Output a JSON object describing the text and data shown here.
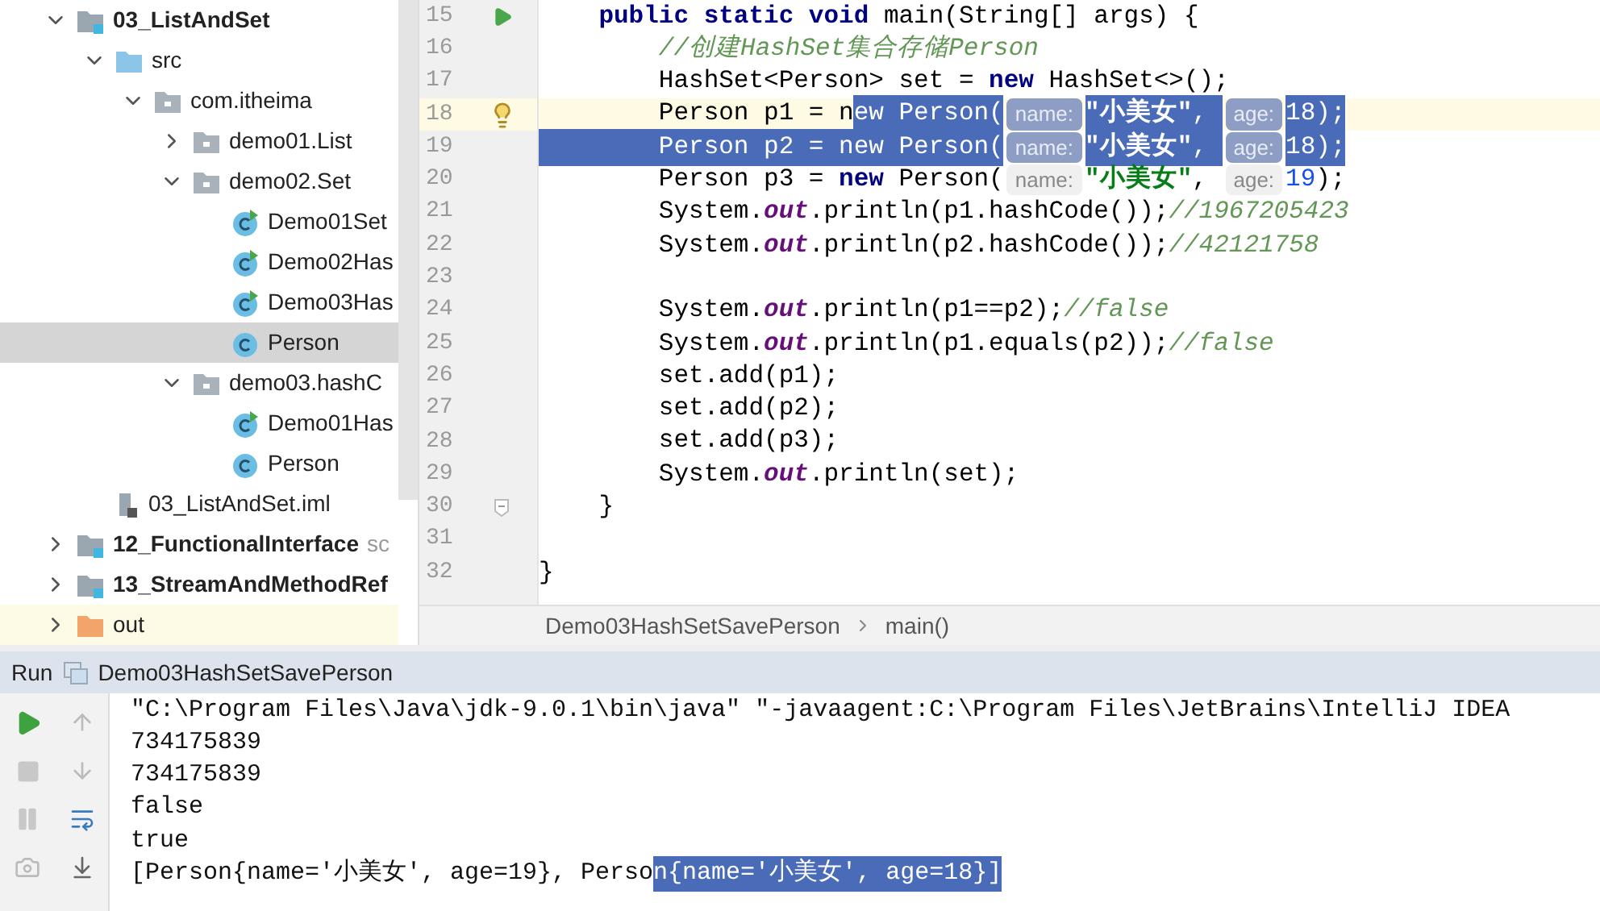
{
  "project_tree": [
    {
      "label": "03_ListAndSet",
      "kind": "module",
      "bold": true,
      "expanded": true,
      "selected": false,
      "highlighted": false,
      "children": [
        {
          "label": "src",
          "kind": "source-folder",
          "bold": false,
          "expanded": true,
          "selected": false,
          "highlighted": false,
          "children": [
            {
              "label": "com.itheima",
              "kind": "package",
              "bold": false,
              "expanded": true,
              "selected": false,
              "highlighted": false,
              "children": [
                {
                  "label": "demo01.List",
                  "kind": "package",
                  "bold": false,
                  "expanded": false,
                  "selected": false,
                  "highlighted": false
                },
                {
                  "label": "demo02.Set",
                  "kind": "package",
                  "bold": false,
                  "expanded": true,
                  "selected": false,
                  "highlighted": false,
                  "children": [
                    {
                      "label": "Demo01Set",
                      "kind": "runnable-class",
                      "bold": false,
                      "selected": false,
                      "highlighted": false
                    },
                    {
                      "label": "Demo02Has",
                      "kind": "runnable-class",
                      "bold": false,
                      "selected": false,
                      "highlighted": false
                    },
                    {
                      "label": "Demo03Has",
                      "kind": "runnable-class",
                      "bold": false,
                      "selected": false,
                      "highlighted": false
                    },
                    {
                      "label": "Person",
                      "kind": "class",
                      "bold": false,
                      "selected": true,
                      "highlighted": false
                    }
                  ]
                },
                {
                  "label": "demo03.hashC",
                  "kind": "package",
                  "bold": false,
                  "expanded": true,
                  "selected": false,
                  "highlighted": false,
                  "children": [
                    {
                      "label": "Demo01Has",
                      "kind": "runnable-class",
                      "bold": false,
                      "selected": false,
                      "highlighted": false
                    },
                    {
                      "label": "Person",
                      "kind": "class",
                      "bold": false,
                      "selected": false,
                      "highlighted": false
                    }
                  ]
                }
              ]
            }
          ]
        },
        {
          "label": "03_ListAndSet.iml",
          "kind": "iml",
          "bold": false,
          "selected": false,
          "highlighted": false
        }
      ]
    },
    {
      "label": "12_FunctionalInterface",
      "suffix": "sc",
      "kind": "module",
      "bold": true,
      "expanded": false,
      "selected": false,
      "highlighted": false
    },
    {
      "label": "13_StreamAndMethodRef",
      "kind": "module",
      "bold": true,
      "expanded": false,
      "selected": false,
      "highlighted": false
    },
    {
      "label": "out",
      "kind": "output-folder",
      "bold": false,
      "expanded": false,
      "selected": false,
      "highlighted": true
    }
  ],
  "editor": {
    "lines": [
      {
        "number": "15",
        "kind": "run",
        "current": false,
        "tokens": [
          {
            "text": "    public static void ",
            "kind": "keyword",
            "selected": false
          },
          {
            "text": "main(String[] args) {",
            "kind": "plain",
            "selected": false
          }
        ]
      },
      {
        "number": "16",
        "kind": "plain",
        "current": false,
        "tokens": [
          {
            "text": "        //创建HashSet集合存储Person",
            "kind": "comment",
            "selected": false
          }
        ]
      },
      {
        "number": "17",
        "kind": "plain",
        "current": false,
        "tokens": [
          {
            "text": "        HashSet<Person> set = ",
            "kind": "plain",
            "selected": false
          },
          {
            "text": "new ",
            "kind": "keyword",
            "selected": false
          },
          {
            "text": "HashSet<>();",
            "kind": "plain",
            "selected": false
          }
        ]
      },
      {
        "number": "18",
        "kind": "bulb",
        "current": true,
        "tokens": [
          {
            "text": "        Person p1 = n",
            "kind": "plain",
            "selected": false
          },
          {
            "text": "ew ",
            "kind": "keyword",
            "selected": true
          },
          {
            "text": "Person(",
            "kind": "plain",
            "selected": true
          },
          {
            "text": "name:",
            "kind": "hint",
            "selected": true
          },
          {
            "text": "\"小美女\"",
            "kind": "string",
            "selected": true
          },
          {
            "text": ", ",
            "kind": "plain",
            "selected": true
          },
          {
            "text": "age:",
            "kind": "hint",
            "selected": true
          },
          {
            "text": "18",
            "kind": "number",
            "selected": true
          },
          {
            "text": ");",
            "kind": "plain",
            "selected": true
          }
        ]
      },
      {
        "number": "19",
        "kind": "plain",
        "current": false,
        "tokens": [
          {
            "text": "        Person p2 = ",
            "kind": "plain",
            "selected": true
          },
          {
            "text": "new ",
            "kind": "keyword",
            "selected": true
          },
          {
            "text": "Person(",
            "kind": "plain",
            "selected": true
          },
          {
            "text": "name:",
            "kind": "hint",
            "selected": true
          },
          {
            "text": "\"小美女\"",
            "kind": "string",
            "selected": true
          },
          {
            "text": ", ",
            "kind": "plain",
            "selected": true
          },
          {
            "text": "age:",
            "kind": "hint",
            "selected": true
          },
          {
            "text": "18",
            "kind": "number",
            "selected": true
          },
          {
            "text": ");",
            "kind": "plain",
            "selected": true
          }
        ]
      },
      {
        "number": "20",
        "kind": "plain",
        "current": false,
        "tokens": [
          {
            "text": "        Person p3 = ",
            "kind": "plain",
            "selected": false
          },
          {
            "text": "new ",
            "kind": "keyword",
            "selected": false
          },
          {
            "text": "Person(",
            "kind": "plain",
            "selected": false
          },
          {
            "text": "name:",
            "kind": "hint",
            "selected": false
          },
          {
            "text": "\"小美女\"",
            "kind": "string",
            "selected": false
          },
          {
            "text": ", ",
            "kind": "plain",
            "selected": false
          },
          {
            "text": "age:",
            "kind": "hint",
            "selected": false
          },
          {
            "text": "19",
            "kind": "number",
            "selected": false
          },
          {
            "text": ");",
            "kind": "plain",
            "selected": false
          }
        ]
      },
      {
        "number": "21",
        "kind": "plain",
        "current": false,
        "tokens": [
          {
            "text": "        System.",
            "kind": "plain",
            "selected": false
          },
          {
            "text": "out",
            "kind": "field",
            "selected": false
          },
          {
            "text": ".println(p1.hashCode());",
            "kind": "plain",
            "selected": false
          },
          {
            "text": "//1967205423",
            "kind": "comment",
            "selected": false
          }
        ]
      },
      {
        "number": "22",
        "kind": "plain",
        "current": false,
        "tokens": [
          {
            "text": "        System.",
            "kind": "plain",
            "selected": false
          },
          {
            "text": "out",
            "kind": "field",
            "selected": false
          },
          {
            "text": ".println(p2.hashCode());",
            "kind": "plain",
            "selected": false
          },
          {
            "text": "//42121758",
            "kind": "comment",
            "selected": false
          }
        ]
      },
      {
        "number": "23",
        "kind": "plain",
        "current": false
      },
      {
        "number": "24",
        "kind": "plain",
        "current": false,
        "tokens": [
          {
            "text": "        System.",
            "kind": "plain",
            "selected": false
          },
          {
            "text": "out",
            "kind": "field",
            "selected": false
          },
          {
            "text": ".println(p1==p2);",
            "kind": "plain",
            "selected": false
          },
          {
            "text": "//false",
            "kind": "comment",
            "selected": false
          }
        ]
      },
      {
        "number": "25",
        "kind": "plain",
        "current": false,
        "tokens": [
          {
            "text": "        System.",
            "kind": "plain",
            "selected": false
          },
          {
            "text": "out",
            "kind": "field",
            "selected": false
          },
          {
            "text": ".println(p1.equals(p2));",
            "kind": "plain",
            "selected": false
          },
          {
            "text": "//false",
            "kind": "comment",
            "selected": false
          }
        ]
      },
      {
        "number": "26",
        "kind": "plain",
        "current": false,
        "tokens": [
          {
            "text": "        set.add(p1);",
            "kind": "plain",
            "selected": false
          }
        ]
      },
      {
        "number": "27",
        "kind": "plain",
        "current": false,
        "tokens": [
          {
            "text": "        set.add(p2);",
            "kind": "plain",
            "selected": false
          }
        ]
      },
      {
        "number": "28",
        "kind": "plain",
        "current": false,
        "tokens": [
          {
            "text": "        set.add(p3);",
            "kind": "plain",
            "selected": false
          }
        ]
      },
      {
        "number": "29",
        "kind": "plain",
        "current": false,
        "tokens": [
          {
            "text": "        System.",
            "kind": "plain",
            "selected": false
          },
          {
            "text": "out",
            "kind": "field",
            "selected": false
          },
          {
            "text": ".println(set);",
            "kind": "plain",
            "selected": false
          }
        ]
      },
      {
        "number": "30",
        "kind": "fold",
        "current": false,
        "tokens": [
          {
            "text": "    }",
            "kind": "plain",
            "selected": false
          }
        ]
      },
      {
        "number": "31",
        "kind": "plain",
        "current": false
      },
      {
        "number": "32",
        "kind": "plain",
        "current": false,
        "tokens": [
          {
            "text": "}",
            "kind": "plain",
            "selected": false
          }
        ]
      }
    ],
    "breadcrumbs": [
      "Demo03HashSetSavePerson",
      "main()"
    ]
  },
  "run_panel": {
    "label": "Run",
    "config": "Demo03HashSetSavePerson",
    "output": [
      [
        {
          "text": "\"C:\\Program Files\\Java\\jdk-9.0.1\\bin\\java\" \"-javaagent:C:\\Program Files\\JetBrains\\IntelliJ IDEA",
          "selected": false
        }
      ],
      [
        {
          "text": "734175839",
          "selected": false
        }
      ],
      [
        {
          "text": "734175839",
          "selected": false
        }
      ],
      [
        {
          "text": "false",
          "selected": false
        }
      ],
      [
        {
          "text": "true",
          "selected": false
        }
      ],
      [
        {
          "text": "[Person{name='小美女', age=19}, Perso",
          "selected": false
        },
        {
          "text": "n{name='小美女', age=18}]",
          "selected": true
        }
      ]
    ]
  }
}
